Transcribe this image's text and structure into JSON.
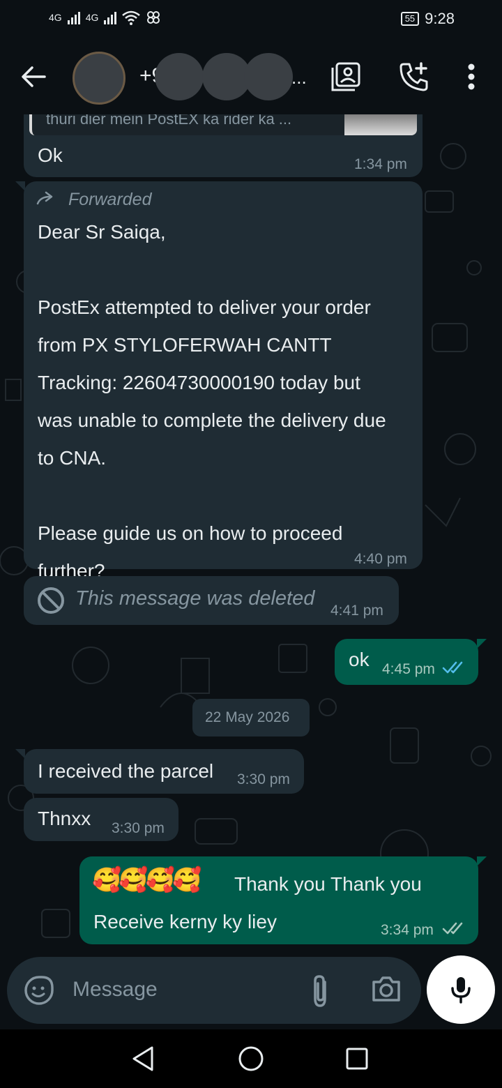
{
  "status_bar": {
    "network1": "4G",
    "network2": "4G",
    "battery": "55",
    "time": "9:28"
  },
  "header": {
    "contact_name": "+9",
    "name_suffix": "..."
  },
  "messages": {
    "quoted_preview": "thuri dier mein PostEX ka rider ka ...",
    "m1_text": "Ok",
    "m1_time": "1:34 pm",
    "m2_forwarded": "Forwarded",
    "m2_text": "Dear Sr Saiqa,\n\nPostEx attempted to deliver your order\nfrom PX STYLOFERWAH CANTT\nTracking: 22604730000190 today but\nwas unable to complete the delivery due\nto CNA.\n\nPlease guide us on how to proceed\nfurther?",
    "m2_time": "4:40 pm",
    "m3_text": "This message was deleted",
    "m3_time": "4:41 pm",
    "m4_text": "ok",
    "m4_time": "4:45 pm",
    "date_chip": "22 May 2026",
    "m5_text": "I received the parcel",
    "m5_time": "3:30 pm",
    "m6_text": "Thnxx",
    "m6_time": "3:30 pm",
    "m7_line1": "Thank you Thank you",
    "m7_emoji": "🥰🥰🥰🥰",
    "m7_line2": "Receive kerny ky liey",
    "m7_time": "3:34 pm"
  },
  "input": {
    "placeholder": "Message"
  },
  "colors": {
    "background": "#0b1014",
    "incoming": "#1f2c34",
    "outgoing": "#005c4b",
    "read_ticks": "#53bdeb",
    "meta": "#8696a0"
  },
  "icons": [
    "back-arrow-icon",
    "video-contact-icon",
    "add-call-icon",
    "more-vert-icon",
    "forward-icon",
    "blocked-icon",
    "double-tick-icon",
    "sticker-icon",
    "attach-icon",
    "camera-icon",
    "mic-icon",
    "nav-back-icon",
    "nav-home-icon",
    "nav-recents-icon"
  ]
}
